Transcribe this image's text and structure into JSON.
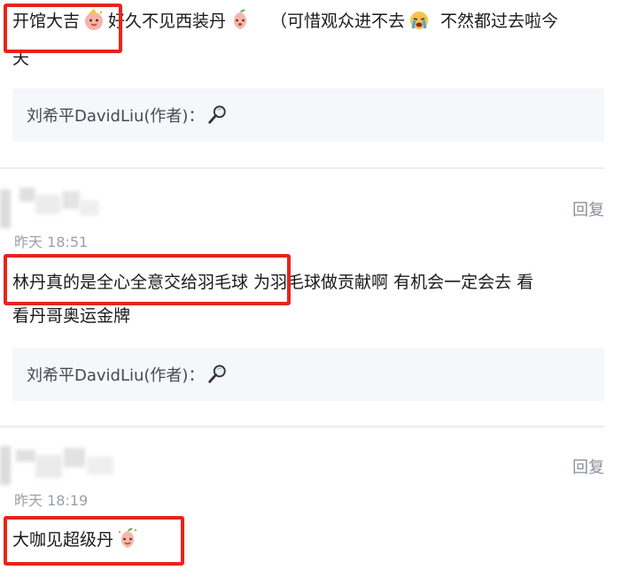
{
  "comments": [
    {
      "text_a": "开馆大吉",
      "text_b": "好久不见西装丹",
      "text_c": "（可惜观众进不去",
      "text_d": "不然都过去啦今",
      "text_e": "天",
      "reply": {
        "author": "刘希平DavidLiu(作者)",
        "sep": "："
      }
    },
    {
      "time": "昨天 18:51",
      "reply_label": "回复",
      "line1": "林丹真的是全心全意交给羽毛球 为羽毛球做贡献啊 有机会一定会去 看",
      "line2": "看丹哥奥运金牌",
      "reply": {
        "author": "刘希平DavidLiu(作者)",
        "sep": "："
      }
    },
    {
      "time": "昨天 18:19",
      "reply_label": "回复",
      "text": "大咖见超级丹"
    }
  ],
  "colors": {
    "highlight": "#e6241c",
    "reply_bg": "#f5f7fa",
    "meta": "#9aa0a8"
  },
  "icons": [
    "party-face-icon",
    "peach-face-icon",
    "crying-face-icon",
    "magnifier-icon"
  ]
}
